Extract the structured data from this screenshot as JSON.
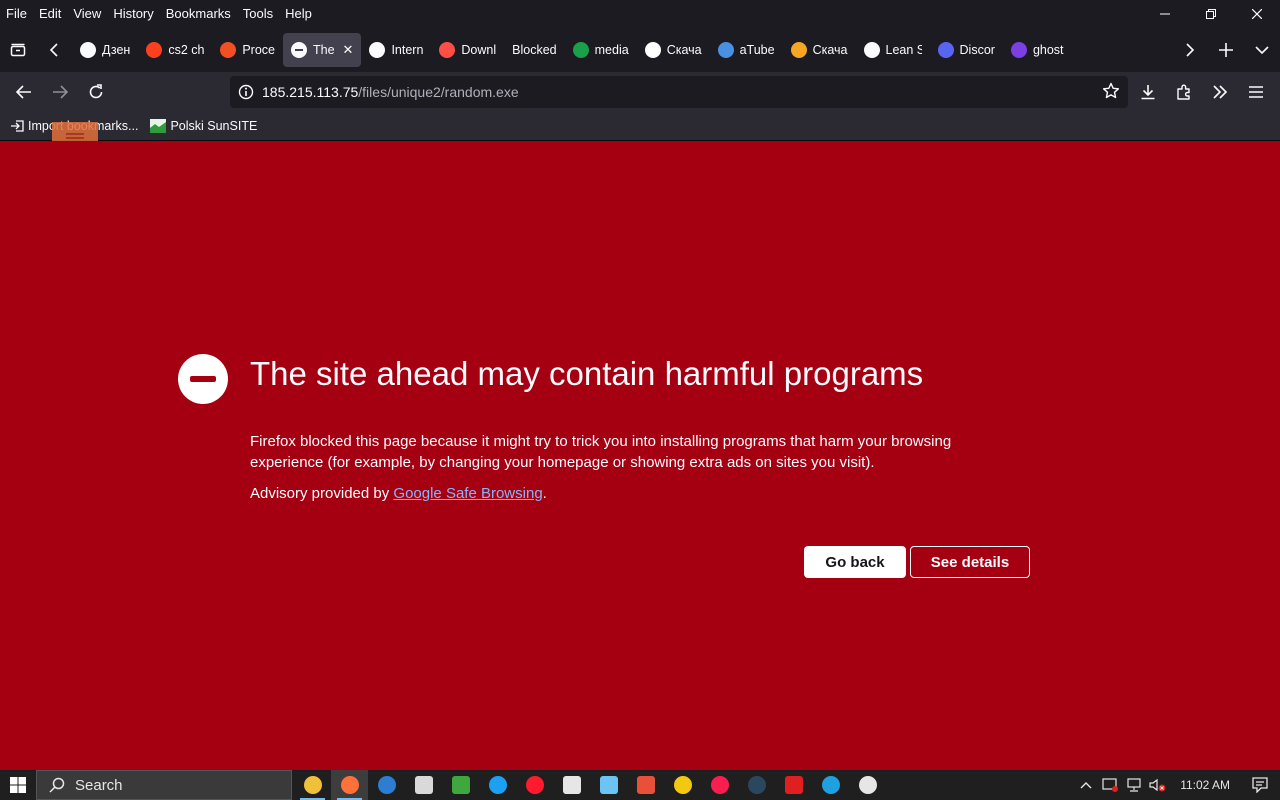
{
  "menubar": {
    "items": [
      "File",
      "Edit",
      "View",
      "History",
      "Bookmarks",
      "Tools",
      "Help"
    ]
  },
  "tabs": [
    {
      "label": "Дзен",
      "icon": "plus-icon",
      "color": "#fbfbfe"
    },
    {
      "label": "cs2 ch",
      "icon": "yandex-icon",
      "color": "#fc3f1d"
    },
    {
      "label": "Proce",
      "icon": "windows-logo-icon",
      "color": "#f25022"
    },
    {
      "label": "The",
      "icon": "blocked-icon",
      "color": "#fbfbfe",
      "active": true
    },
    {
      "label": "Intern",
      "icon": "archive-icon",
      "color": "#fbfbfe"
    },
    {
      "label": "Downl",
      "icon": "play-icon",
      "color": "#ff4e45"
    },
    {
      "label": "Blocked",
      "icon": "none",
      "color": "#1c1b22"
    },
    {
      "label": "media",
      "icon": "media-icon",
      "color": "#1a9f4a"
    },
    {
      "label": "Скача",
      "icon": "t-icon",
      "color": "#ffffff"
    },
    {
      "label": "aTube",
      "icon": "id-icon",
      "color": "#4a90e2"
    },
    {
      "label": "Скача",
      "icon": "ps-icon",
      "color": "#f5a623"
    },
    {
      "label": "Lean S",
      "icon": "lean-icon",
      "color": "#fbfbfe"
    },
    {
      "label": "Discor",
      "icon": "discord-icon",
      "color": "#5865f2"
    },
    {
      "label": "ghost",
      "icon": "ghost-icon",
      "color": "#7b3fe4"
    }
  ],
  "navbar": {
    "url_host": "185.215.113.75",
    "url_path": "/files/unique2/random.exe"
  },
  "bookmarks": [
    {
      "label": "Import bookmarks...",
      "icon": "import-icon"
    },
    {
      "label": "Polski SunSITE",
      "icon": "sunsite-icon"
    }
  ],
  "error": {
    "title": "The site ahead may contain harmful programs",
    "description": "Firefox blocked this page because it might try to trick you into installing programs that harm your browsing experience (for example, by changing your homepage or showing extra ads on sites you visit).",
    "advisory_prefix": "Advisory provided by ",
    "advisory_link": "Google Safe Browsing",
    "advisory_suffix": ".",
    "go_back": "Go back",
    "see_details": "See details"
  },
  "taskbar": {
    "search_label": "Search",
    "time": "11:02 AM",
    "apps": [
      {
        "name": "file-explorer-icon",
        "color": "#f0c03a",
        "running": true
      },
      {
        "name": "firefox-icon",
        "color": "#ff7139",
        "running": true,
        "active": true
      },
      {
        "name": "globe-app-icon",
        "color": "#2d7dd2"
      },
      {
        "name": "notepad-app-icon",
        "color": "#d9d9d9"
      },
      {
        "name": "download-app-icon",
        "color": "#3ea83e"
      },
      {
        "name": "internet-explorer-icon",
        "color": "#1ea0f2"
      },
      {
        "name": "opera-icon",
        "color": "#ff1b2d"
      },
      {
        "name": "settings-gear-icon",
        "color": "#e6e6e6"
      },
      {
        "name": "notes-app-icon",
        "color": "#6cc4f5"
      },
      {
        "name": "media-player-icon",
        "color": "#e8503a"
      },
      {
        "name": "smiley-app-icon",
        "color": "#f2c811"
      },
      {
        "name": "opera-gx-icon",
        "color": "#fa1e4e"
      },
      {
        "name": "steam-like-icon",
        "color": "#2a475e"
      },
      {
        "name": "pdf-app-icon",
        "color": "#e02020"
      },
      {
        "name": "edge-icon",
        "color": "#1fa0e0"
      },
      {
        "name": "copyright-app-icon",
        "color": "#e6e6e6"
      }
    ]
  },
  "colors": {
    "page_bg": "#a50012",
    "chrome_bg": "#1c1b22",
    "toolbar_bg": "#2b2a33",
    "link": "#8ab4f8"
  }
}
